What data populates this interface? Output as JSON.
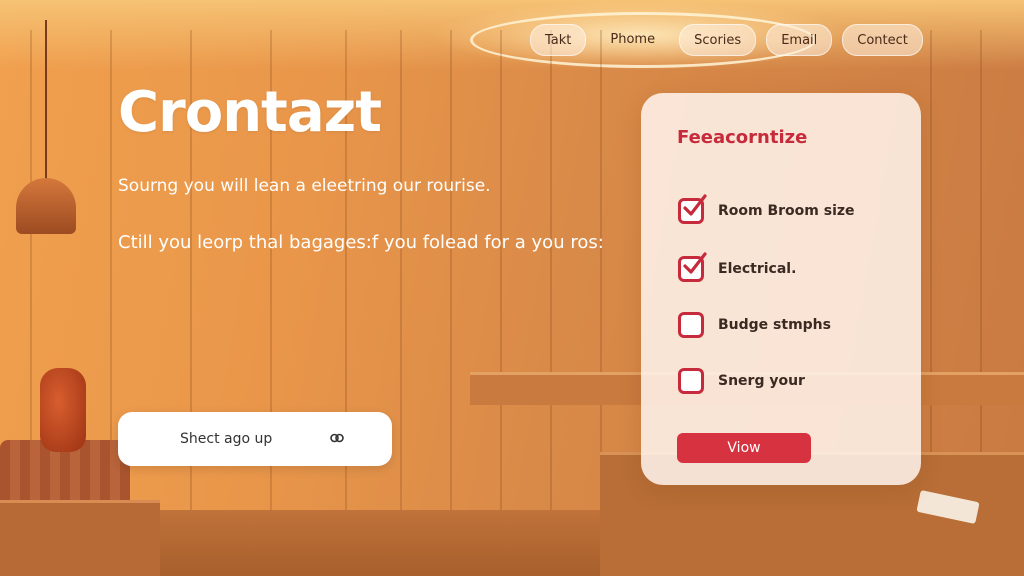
{
  "nav": {
    "items": [
      {
        "label": "Takt"
      },
      {
        "label": "Phome"
      },
      {
        "label": "Scories"
      },
      {
        "label": "Email"
      },
      {
        "label": "Contect"
      }
    ]
  },
  "hero": {
    "title": "Crontazt",
    "line1": "Sourng you will lean a eleetring our rourise.",
    "line2": "Ctill you leorp thal bagages:f you folead for a you ros:"
  },
  "cta": {
    "label": "Shect ago up",
    "icon": "link-icon"
  },
  "panel": {
    "title": "Feeacorntize",
    "options": [
      {
        "label": "Room Broom size",
        "checked": true
      },
      {
        "label": "Electrical.",
        "checked": true
      },
      {
        "label": "Budge stmphs",
        "checked": false
      },
      {
        "label": "Snerg your",
        "checked": false
      }
    ],
    "button": "Viow"
  },
  "colors": {
    "accent": "#d6323f",
    "panel_bg": "#fff5ee",
    "background": "#e9964a"
  }
}
